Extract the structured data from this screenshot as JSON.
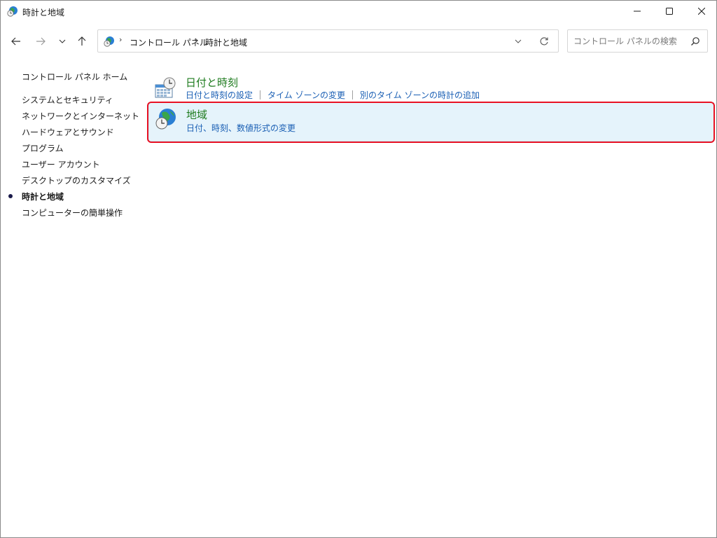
{
  "window": {
    "title": "時計と地域"
  },
  "address": {
    "crumbs": [
      "コントロール パネル",
      "時計と地域"
    ]
  },
  "search": {
    "placeholder": "コントロール パネルの検索"
  },
  "sidebar": {
    "home": "コントロール パネル ホーム",
    "items": [
      {
        "label": "システムとセキュリティ",
        "current": false
      },
      {
        "label": "ネットワークとインターネット",
        "current": false
      },
      {
        "label": "ハードウェアとサウンド",
        "current": false
      },
      {
        "label": "プログラム",
        "current": false
      },
      {
        "label": "ユーザー アカウント",
        "current": false
      },
      {
        "label": "デスクトップのカスタマイズ",
        "current": false
      },
      {
        "label": "時計と地域",
        "current": true
      },
      {
        "label": "コンピューターの簡単操作",
        "current": false
      }
    ]
  },
  "categories": [
    {
      "title": "日付と時刻",
      "icon": "calendar-clock-icon",
      "links": [
        "日付と時刻の設定",
        "タイム ゾーンの変更",
        "別のタイム ゾーンの時計の追加"
      ]
    },
    {
      "title": "地域",
      "icon": "globe-clock-icon",
      "links": [
        "日付、時刻、数値形式の変更"
      ],
      "selected": true
    }
  ],
  "colors": {
    "category_title": "#1e7b1e",
    "link": "#1a5fb4",
    "selected_bg": "#e5f3fb",
    "highlight_border": "#e81123"
  }
}
